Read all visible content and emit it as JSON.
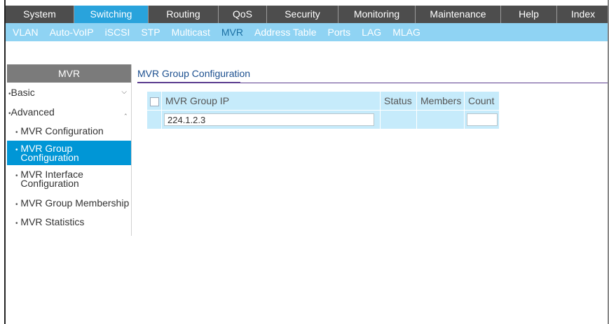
{
  "topnav": {
    "tabs": [
      {
        "label": "System",
        "width": 98
      },
      {
        "label": "Switching",
        "width": 106,
        "active": true
      },
      {
        "label": "Routing",
        "width": 100
      },
      {
        "label": "QoS",
        "width": 69
      },
      {
        "label": "Security",
        "width": 102
      },
      {
        "label": "Monitoring",
        "width": 110
      },
      {
        "label": "Maintenance",
        "width": 122
      },
      {
        "label": "Help",
        "width": 80
      },
      {
        "label": "Index",
        "width": 74
      }
    ]
  },
  "subnav": {
    "items": [
      "VLAN",
      "Auto-VoIP",
      "iSCSI",
      "STP",
      "Multicast",
      "MVR",
      "Address Table",
      "Ports",
      "LAG",
      "MLAG"
    ],
    "active": "MVR"
  },
  "sidebar": {
    "header": "MVR",
    "basic": "Basic",
    "advanced": "Advanced",
    "items": [
      {
        "label": "MVR Configuration"
      },
      {
        "label1": "MVR Group",
        "label2": "Configuration"
      },
      {
        "label1": "MVR Interface",
        "label2": "Configuration"
      },
      {
        "label": "MVR Group Membership"
      },
      {
        "label": "MVR Statistics"
      }
    ]
  },
  "main": {
    "section_title": "MVR Group Configuration",
    "table": {
      "headers": {
        "group_ip": "MVR Group IP",
        "status": "Status",
        "members": "Members",
        "count": "Count"
      },
      "row": {
        "group_ip_value": "224.1.2.3",
        "count_value": ""
      }
    }
  },
  "colors": {
    "active_tab": "#29a3dc",
    "subnav_bg": "#8fd3f3",
    "sidebar_active": "#0096d6",
    "table_bg": "#c6ebfb"
  }
}
